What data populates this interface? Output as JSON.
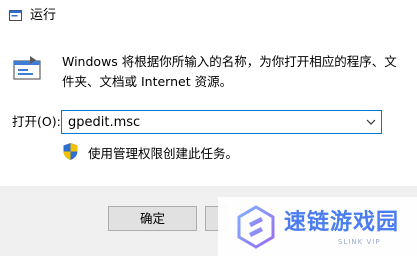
{
  "window": {
    "title": "运行",
    "icon": "run-app-icon"
  },
  "content": {
    "description": "Windows 将根据你所输入的名称，为你打开相应的程序、文件夹、文档或 Internet 资源。",
    "run_icon": "run-dialog-icon",
    "open_label": "打开(O):",
    "open_value": "gpedit.msc",
    "admin_note": "使用管理权限创建此任务。",
    "shield_icon": "uac-shield-icon"
  },
  "buttons": {
    "ok_label": "确定",
    "cancel_label": ""
  },
  "watermark": {
    "title": "速链游戏园",
    "subtitle": "SLINK VIP"
  },
  "colors": {
    "accent": "#0078d7",
    "footer_bg": "#f0f0f0",
    "watermark_blue": "#4a7df0"
  }
}
